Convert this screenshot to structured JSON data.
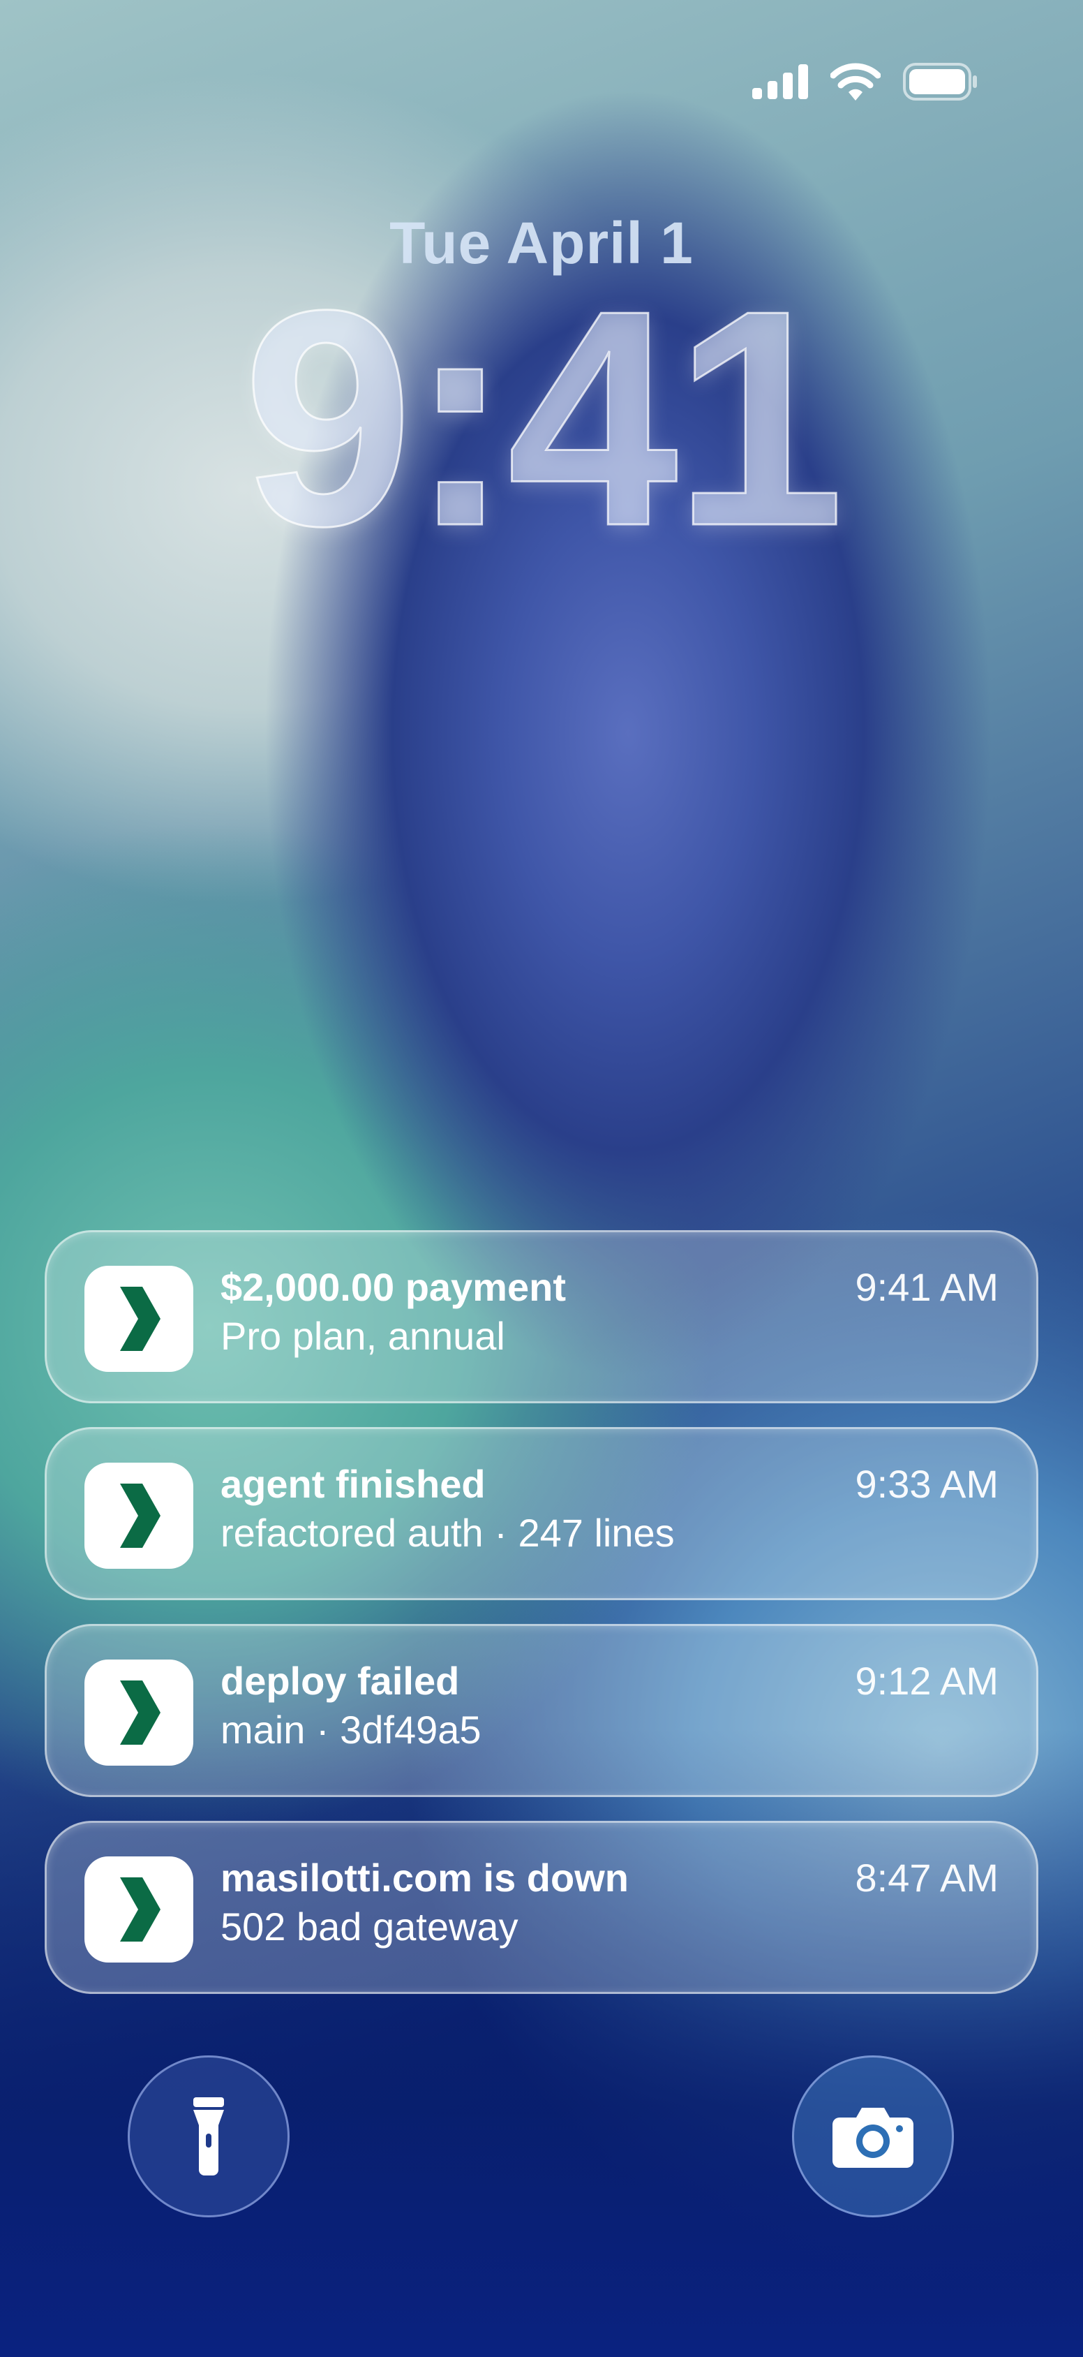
{
  "status_bar": {
    "icons": [
      "cellular-signal-icon",
      "wifi-icon",
      "battery-icon"
    ]
  },
  "lock_screen": {
    "date": "Tue April 1",
    "time": "9:41"
  },
  "notifications": [
    {
      "app_icon": "chevron-right-icon",
      "title": "$2,000.00 payment",
      "body": "Pro plan, annual",
      "time": "9:41 AM"
    },
    {
      "app_icon": "chevron-right-icon",
      "title": "agent finished",
      "body": "refactored auth · 247 lines",
      "time": "9:33 AM"
    },
    {
      "app_icon": "chevron-right-icon",
      "title": "deploy failed",
      "body": "main · 3df49a5",
      "time": "9:12 AM"
    },
    {
      "app_icon": "chevron-right-icon",
      "title": "masilotti.com is down",
      "body": "502 bad gateway",
      "time": "8:47 AM"
    }
  ],
  "quick_actions": {
    "left": "flashlight-icon",
    "right": "camera-icon"
  },
  "colors": {
    "app_icon_accent": "#0b6b45",
    "app_icon_background": "#ffffff"
  }
}
